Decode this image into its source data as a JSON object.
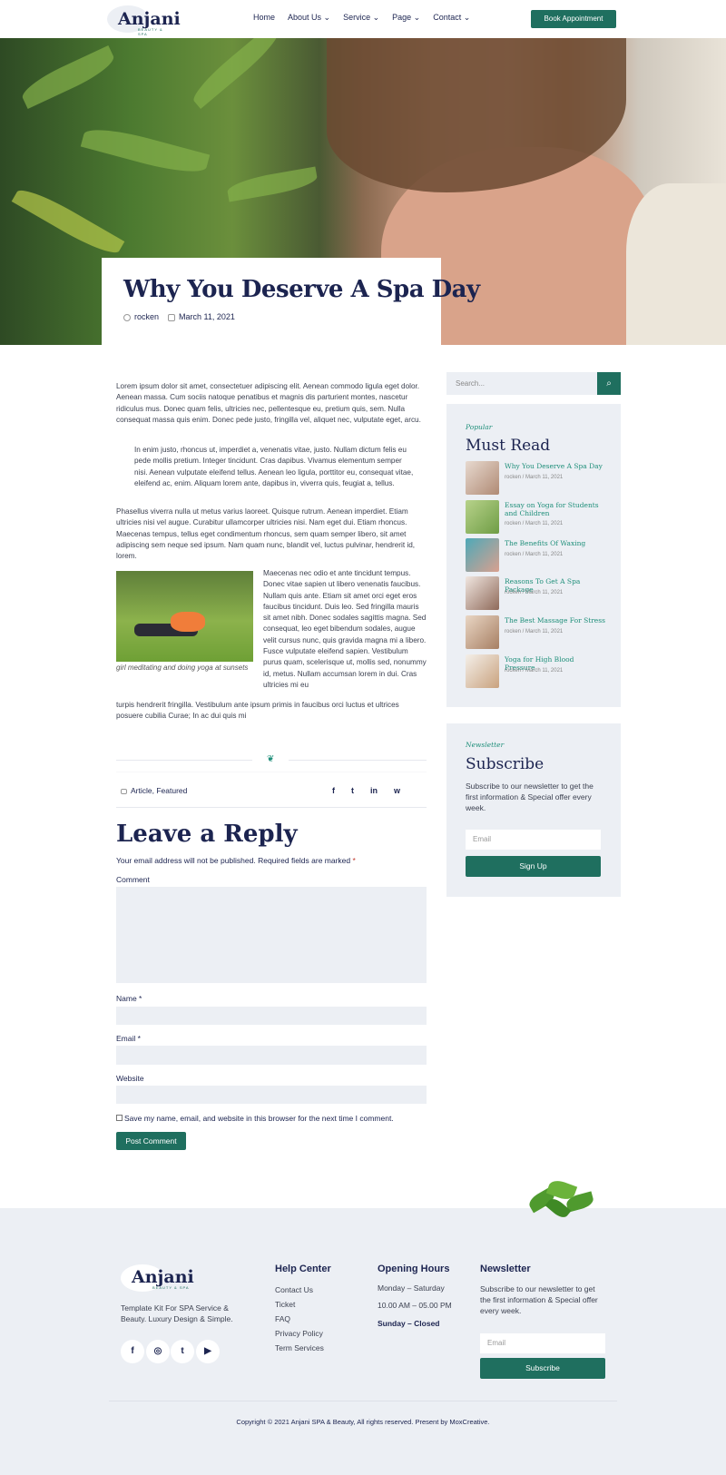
{
  "header": {
    "logo": "Anjani",
    "logo_sub": "BEAUTY & SPA",
    "nav": [
      "Home",
      "About Us ⌄",
      "Service ⌄",
      "Page ⌄",
      "Contact ⌄"
    ],
    "cta": "Book Appointment"
  },
  "post": {
    "title": "Why You Deserve A Spa Day",
    "author": "rocken",
    "date": "March 11, 2021",
    "p1": "Lorem ipsum dolor sit amet, consectetuer adipiscing elit. Aenean commodo ligula eget dolor. Aenean massa. Cum sociis natoque penatibus et magnis dis parturient montes, nascetur ridiculus mus. Donec quam felis, ultricies nec, pellentesque eu, pretium quis, sem. Nulla consequat massa quis enim. Donec pede justo, fringilla vel, aliquet nec, vulputate eget, arcu.",
    "quote": "In enim justo, rhoncus ut, imperdiet a, venenatis vitae, justo. Nullam dictum felis eu pede mollis pretium. Integer tincidunt. Cras dapibus. Vivamus elementum semper nisi. Aenean vulputate eleifend tellus. Aenean leo ligula, porttitor eu, consequat vitae, eleifend ac, enim. Aliquam lorem ante, dapibus in, viverra quis, feugiat a, tellus.",
    "p2": "Phasellus viverra nulla ut metus varius laoreet. Quisque rutrum. Aenean imperdiet. Etiam ultricies nisi vel augue. Curabitur ullamcorper ultricies nisi. Nam eget dui. Etiam rhoncus. Maecenas tempus, tellus eget condimentum rhoncus, sem quam semper libero, sit amet adipiscing sem neque sed ipsum. Nam quam nunc, blandit vel, luctus pulvinar, hendrerit id, lorem.",
    "p3_side": "Maecenas nec odio et ante tincidunt tempus. Donec vitae sapien ut libero venenatis faucibus. Nullam quis ante. Etiam sit amet orci eget eros faucibus tincidunt. Duis leo. Sed fringilla mauris sit amet nibh. Donec sodales sagittis magna. Sed consequat, leo eget bibendum sodales, augue velit cursus nunc, quis gravida magna mi a libero. Fusce vulputate eleifend sapien. Vestibulum purus quam, scelerisque ut, mollis sed, nonummy id, metus. Nullam accumsan lorem in dui. Cras ultricies mi eu",
    "p3_full": "turpis hendrerit fringilla. Vestibulum ante ipsum primis in faucibus orci luctus et ultrices posuere cubilia Curae; In ac dui quis mi",
    "image_caption": "girl meditating and doing yoga at sunsets",
    "tags": "Article, Featured"
  },
  "social_share": [
    "f",
    "t",
    "in",
    "w"
  ],
  "reply": {
    "title": "Leave a Reply",
    "note": "Your email address will not be published. Required fields are marked ",
    "required_mark": "*",
    "comment_label": "Comment",
    "name_label": "Name *",
    "email_label": "Email *",
    "website_label": "Website",
    "save_label": "Save my name, email, and website in this browser for the next time I comment.",
    "submit": "Post Comment"
  },
  "sidebar": {
    "search_placeholder": "Search...",
    "popular_kicker": "Popular",
    "popular_title": "Must Read",
    "items": [
      {
        "title": "Why You Deserve A Spa Day",
        "meta": "rocken / March 11, 2021"
      },
      {
        "title": "Essay on Yoga for Students and Children",
        "meta": "rocken / March 11, 2021"
      },
      {
        "title": "The Benefits Of Waxing",
        "meta": "rocken / March 11, 2021"
      },
      {
        "title": "Reasons To Get A Spa Package",
        "meta": "rocken / March 11, 2021"
      },
      {
        "title": "The Best Massage For Stress",
        "meta": "rocken / March 11, 2021"
      },
      {
        "title": "Yoga for High Blood Pressure",
        "meta": "rocken / March 11, 2021"
      }
    ],
    "newsletter_kicker": "Newsletter",
    "newsletter_title": "Subscribe",
    "newsletter_text": "Subscribe to our newsletter to get the first information & Special offer every week.",
    "email_placeholder": "Email",
    "signup": "Sign Up"
  },
  "footer": {
    "logo": "Anjani",
    "logo_sub": "BEAUTY & SPA",
    "about": "Template Kit For SPA Service & Beauty. Luxury Design & Simple.",
    "help_title": "Help Center",
    "help_links": [
      "Contact Us",
      "Ticket",
      "FAQ",
      "Privacy Policy",
      "Term Services"
    ],
    "hours_title": "Opening Hours",
    "hours_days": "Monday – Saturday",
    "hours_time": "10.00 AM – 05.00 PM",
    "hours_closed": "Sunday – Closed",
    "newsletter_title": "Newsletter",
    "newsletter_text": "Subscribe to our newsletter to get the first information & Special offer every week.",
    "email_placeholder": "Email",
    "subscribe": "Subscribe",
    "copyright": "Copyright © 2021 Anjani SPA & Beauty, All rights reserved. Present by MoxCreative."
  },
  "colors": {
    "primary": "#1f6f5f",
    "navy": "#1c2450",
    "accent_text": "#1f8f7a",
    "panel": "#eceff4"
  }
}
